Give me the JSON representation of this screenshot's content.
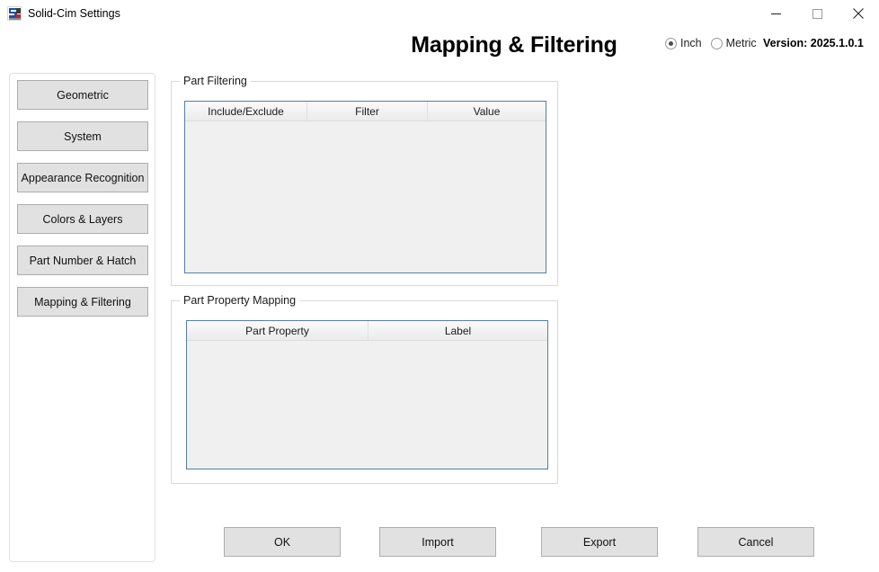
{
  "window": {
    "title": "Solid-Cim Settings",
    "icon": "app-logo-icon",
    "controls": {
      "minimize": "minimize-icon",
      "maximize": "maximize-icon",
      "close": "close-icon"
    }
  },
  "header": {
    "page_title": "Mapping & Filtering",
    "units": {
      "inch_label": "Inch",
      "metric_label": "Metric",
      "selected": "Inch"
    },
    "version": "Version: 2025.1.0.1"
  },
  "sidebar": {
    "items": [
      {
        "label": "Geometric"
      },
      {
        "label": "System"
      },
      {
        "label": "Appearance Recognition"
      },
      {
        "label": "Colors & Layers"
      },
      {
        "label": "Part Number & Hatch"
      },
      {
        "label": "Mapping & Filtering"
      }
    ]
  },
  "part_filtering": {
    "legend": "Part Filtering",
    "columns": [
      "Include/Exclude",
      "Filter",
      "Value"
    ],
    "rows": []
  },
  "part_property_mapping": {
    "legend": "Part Property Mapping",
    "columns": [
      "Part Property",
      "Label"
    ],
    "rows": []
  },
  "footer": {
    "ok": "OK",
    "import": "Import",
    "export": "Export",
    "cancel": "Cancel"
  },
  "colors": {
    "button_face": "#e1e1e1",
    "button_border": "#adadad",
    "grid_border": "#5a7ca8",
    "grid_body": "#f0f0f0",
    "panel_border": "#dbe3e8",
    "background": "#ffffff"
  }
}
